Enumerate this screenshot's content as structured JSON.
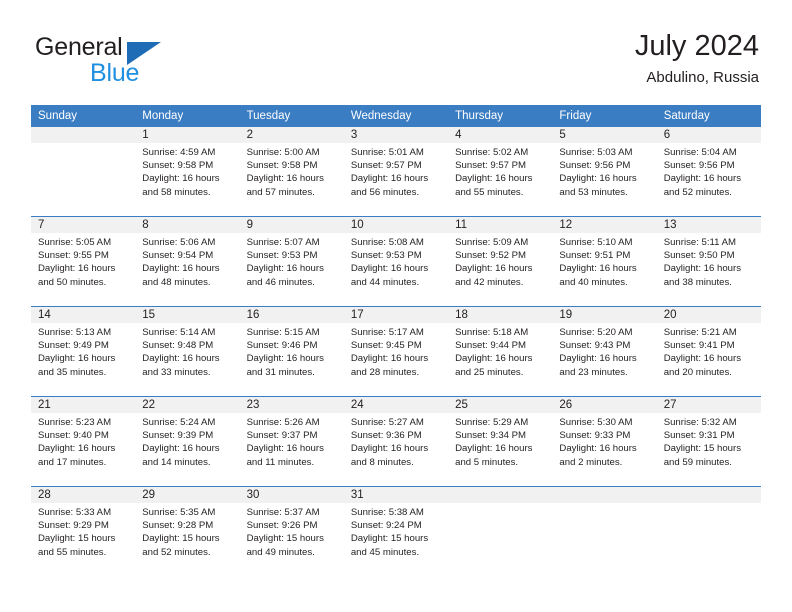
{
  "brand": {
    "name_top": "General",
    "name_bottom": "Blue",
    "triangle_color": "#1d6cb5",
    "blue_color": "#1f8fe0"
  },
  "header": {
    "title": "July 2024",
    "location": "Abdulino, Russia"
  },
  "theme": {
    "header_blue": "#3b7dc3",
    "daynum_bg": "#f1f1f1",
    "text": "#231f20"
  },
  "calendar": {
    "weekday_headers": [
      "Sunday",
      "Monday",
      "Tuesday",
      "Wednesday",
      "Thursday",
      "Friday",
      "Saturday"
    ],
    "weeks": [
      [
        {
          "day": "",
          "sunrise": "",
          "sunset": "",
          "daylight_line1": "",
          "daylight_line2": ""
        },
        {
          "day": "1",
          "sunrise": "Sunrise: 4:59 AM",
          "sunset": "Sunset: 9:58 PM",
          "daylight_line1": "Daylight: 16 hours",
          "daylight_line2": "and 58 minutes."
        },
        {
          "day": "2",
          "sunrise": "Sunrise: 5:00 AM",
          "sunset": "Sunset: 9:58 PM",
          "daylight_line1": "Daylight: 16 hours",
          "daylight_line2": "and 57 minutes."
        },
        {
          "day": "3",
          "sunrise": "Sunrise: 5:01 AM",
          "sunset": "Sunset: 9:57 PM",
          "daylight_line1": "Daylight: 16 hours",
          "daylight_line2": "and 56 minutes."
        },
        {
          "day": "4",
          "sunrise": "Sunrise: 5:02 AM",
          "sunset": "Sunset: 9:57 PM",
          "daylight_line1": "Daylight: 16 hours",
          "daylight_line2": "and 55 minutes."
        },
        {
          "day": "5",
          "sunrise": "Sunrise: 5:03 AM",
          "sunset": "Sunset: 9:56 PM",
          "daylight_line1": "Daylight: 16 hours",
          "daylight_line2": "and 53 minutes."
        },
        {
          "day": "6",
          "sunrise": "Sunrise: 5:04 AM",
          "sunset": "Sunset: 9:56 PM",
          "daylight_line1": "Daylight: 16 hours",
          "daylight_line2": "and 52 minutes."
        }
      ],
      [
        {
          "day": "7",
          "sunrise": "Sunrise: 5:05 AM",
          "sunset": "Sunset: 9:55 PM",
          "daylight_line1": "Daylight: 16 hours",
          "daylight_line2": "and 50 minutes."
        },
        {
          "day": "8",
          "sunrise": "Sunrise: 5:06 AM",
          "sunset": "Sunset: 9:54 PM",
          "daylight_line1": "Daylight: 16 hours",
          "daylight_line2": "and 48 minutes."
        },
        {
          "day": "9",
          "sunrise": "Sunrise: 5:07 AM",
          "sunset": "Sunset: 9:53 PM",
          "daylight_line1": "Daylight: 16 hours",
          "daylight_line2": "and 46 minutes."
        },
        {
          "day": "10",
          "sunrise": "Sunrise: 5:08 AM",
          "sunset": "Sunset: 9:53 PM",
          "daylight_line1": "Daylight: 16 hours",
          "daylight_line2": "and 44 minutes."
        },
        {
          "day": "11",
          "sunrise": "Sunrise: 5:09 AM",
          "sunset": "Sunset: 9:52 PM",
          "daylight_line1": "Daylight: 16 hours",
          "daylight_line2": "and 42 minutes."
        },
        {
          "day": "12",
          "sunrise": "Sunrise: 5:10 AM",
          "sunset": "Sunset: 9:51 PM",
          "daylight_line1": "Daylight: 16 hours",
          "daylight_line2": "and 40 minutes."
        },
        {
          "day": "13",
          "sunrise": "Sunrise: 5:11 AM",
          "sunset": "Sunset: 9:50 PM",
          "daylight_line1": "Daylight: 16 hours",
          "daylight_line2": "and 38 minutes."
        }
      ],
      [
        {
          "day": "14",
          "sunrise": "Sunrise: 5:13 AM",
          "sunset": "Sunset: 9:49 PM",
          "daylight_line1": "Daylight: 16 hours",
          "daylight_line2": "and 35 minutes."
        },
        {
          "day": "15",
          "sunrise": "Sunrise: 5:14 AM",
          "sunset": "Sunset: 9:48 PM",
          "daylight_line1": "Daylight: 16 hours",
          "daylight_line2": "and 33 minutes."
        },
        {
          "day": "16",
          "sunrise": "Sunrise: 5:15 AM",
          "sunset": "Sunset: 9:46 PM",
          "daylight_line1": "Daylight: 16 hours",
          "daylight_line2": "and 31 minutes."
        },
        {
          "day": "17",
          "sunrise": "Sunrise: 5:17 AM",
          "sunset": "Sunset: 9:45 PM",
          "daylight_line1": "Daylight: 16 hours",
          "daylight_line2": "and 28 minutes."
        },
        {
          "day": "18",
          "sunrise": "Sunrise: 5:18 AM",
          "sunset": "Sunset: 9:44 PM",
          "daylight_line1": "Daylight: 16 hours",
          "daylight_line2": "and 25 minutes."
        },
        {
          "day": "19",
          "sunrise": "Sunrise: 5:20 AM",
          "sunset": "Sunset: 9:43 PM",
          "daylight_line1": "Daylight: 16 hours",
          "daylight_line2": "and 23 minutes."
        },
        {
          "day": "20",
          "sunrise": "Sunrise: 5:21 AM",
          "sunset": "Sunset: 9:41 PM",
          "daylight_line1": "Daylight: 16 hours",
          "daylight_line2": "and 20 minutes."
        }
      ],
      [
        {
          "day": "21",
          "sunrise": "Sunrise: 5:23 AM",
          "sunset": "Sunset: 9:40 PM",
          "daylight_line1": "Daylight: 16 hours",
          "daylight_line2": "and 17 minutes."
        },
        {
          "day": "22",
          "sunrise": "Sunrise: 5:24 AM",
          "sunset": "Sunset: 9:39 PM",
          "daylight_line1": "Daylight: 16 hours",
          "daylight_line2": "and 14 minutes."
        },
        {
          "day": "23",
          "sunrise": "Sunrise: 5:26 AM",
          "sunset": "Sunset: 9:37 PM",
          "daylight_line1": "Daylight: 16 hours",
          "daylight_line2": "and 11 minutes."
        },
        {
          "day": "24",
          "sunrise": "Sunrise: 5:27 AM",
          "sunset": "Sunset: 9:36 PM",
          "daylight_line1": "Daylight: 16 hours",
          "daylight_line2": "and 8 minutes."
        },
        {
          "day": "25",
          "sunrise": "Sunrise: 5:29 AM",
          "sunset": "Sunset: 9:34 PM",
          "daylight_line1": "Daylight: 16 hours",
          "daylight_line2": "and 5 minutes."
        },
        {
          "day": "26",
          "sunrise": "Sunrise: 5:30 AM",
          "sunset": "Sunset: 9:33 PM",
          "daylight_line1": "Daylight: 16 hours",
          "daylight_line2": "and 2 minutes."
        },
        {
          "day": "27",
          "sunrise": "Sunrise: 5:32 AM",
          "sunset": "Sunset: 9:31 PM",
          "daylight_line1": "Daylight: 15 hours",
          "daylight_line2": "and 59 minutes."
        }
      ],
      [
        {
          "day": "28",
          "sunrise": "Sunrise: 5:33 AM",
          "sunset": "Sunset: 9:29 PM",
          "daylight_line1": "Daylight: 15 hours",
          "daylight_line2": "and 55 minutes."
        },
        {
          "day": "29",
          "sunrise": "Sunrise: 5:35 AM",
          "sunset": "Sunset: 9:28 PM",
          "daylight_line1": "Daylight: 15 hours",
          "daylight_line2": "and 52 minutes."
        },
        {
          "day": "30",
          "sunrise": "Sunrise: 5:37 AM",
          "sunset": "Sunset: 9:26 PM",
          "daylight_line1": "Daylight: 15 hours",
          "daylight_line2": "and 49 minutes."
        },
        {
          "day": "31",
          "sunrise": "Sunrise: 5:38 AM",
          "sunset": "Sunset: 9:24 PM",
          "daylight_line1": "Daylight: 15 hours",
          "daylight_line2": "and 45 minutes."
        },
        {
          "day": "",
          "sunrise": "",
          "sunset": "",
          "daylight_line1": "",
          "daylight_line2": ""
        },
        {
          "day": "",
          "sunrise": "",
          "sunset": "",
          "daylight_line1": "",
          "daylight_line2": ""
        },
        {
          "day": "",
          "sunrise": "",
          "sunset": "",
          "daylight_line1": "",
          "daylight_line2": ""
        }
      ]
    ]
  }
}
